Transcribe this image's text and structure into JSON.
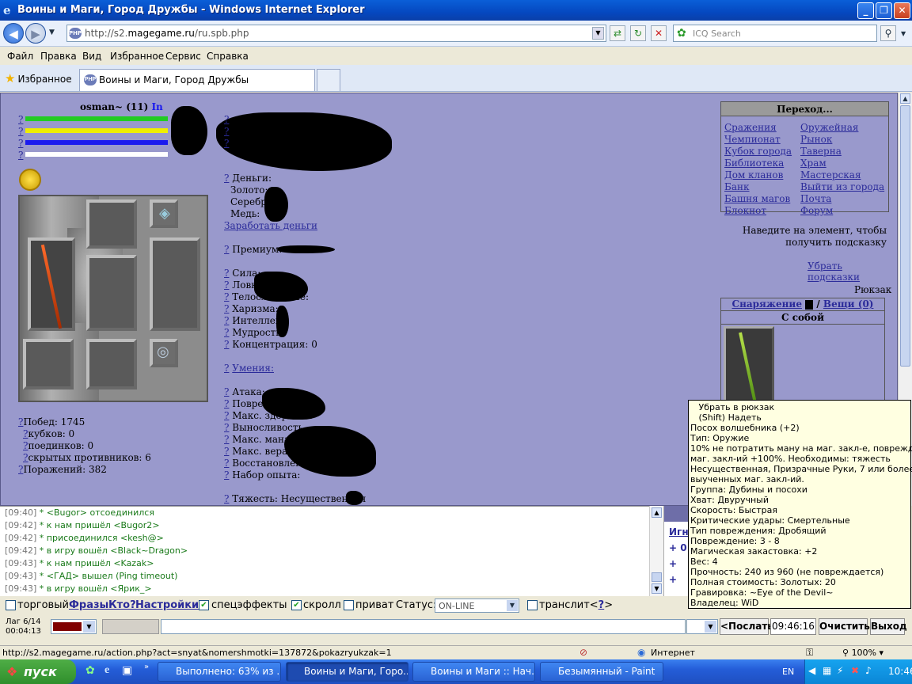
{
  "window": {
    "title": "Воины и Маги, Город Дружбы - Windows Internet Explorer",
    "min": "_",
    "max": "❐",
    "close": "✕"
  },
  "address": {
    "url_prefix": "http://s2.",
    "url_host": "magegame.ru",
    "url_path": "/ru.spb.php",
    "search_placeholder": "ICQ Search",
    "favicon": "PHP"
  },
  "menu": [
    "Файл",
    "Правка",
    "Вид",
    "Избранное",
    "Сервис",
    "Справка"
  ],
  "favorites": {
    "label": "Избранное",
    "tab_title": "Воины и Маги, Город Дружбы"
  },
  "character": {
    "name": "osman~ (11)",
    "in_label": "In",
    "bars": [
      {
        "color": "#22cc22",
        "fill": 1.0
      },
      {
        "color": "#eeee00",
        "fill": 1.0
      },
      {
        "color": "#1a1aee",
        "fill": 1.0
      },
      {
        "color": "#ffffff",
        "fill": 1.0
      }
    ],
    "q": "?",
    "wins": "Побед: 1745",
    "cups": "кубков: 0",
    "duels": "поединков: 0",
    "hidden": "скрытых противников: 6",
    "losses": "Поражений: 382"
  },
  "stats": {
    "money": "Деньги:",
    "gold": "Золото:",
    "silver": "Серебро",
    "copper": "Медь:",
    "earn": "Заработать деньги",
    "premium": "Премиум:",
    "strength": "Сила:",
    "agility": "Ловкость",
    "constitution": "Телосложение:",
    "charisma": "Харизма:",
    "intellect": "Интеллект:",
    "wisdom": "Мудрость:",
    "concentration": "Концентрация: 0",
    "skills": "Умения:",
    "attack": "Атака:",
    "damage": "Поврежден",
    "max_health": "Макс. здоровье:",
    "endurance": "Выносливость",
    "max_mana": "Макс. мана:",
    "max_faith": "Макс. вера:",
    "regen": "Восстановление здоровья:",
    "exp": "Набор опыта:",
    "weight": "Тяжесть: Несущественная"
  },
  "nav": {
    "header": "Переход...",
    "left": [
      "Сражения",
      "Чемпионат",
      "Кубок города",
      "Библиотека",
      "Дом кланов",
      "Банк",
      "Башня магов",
      "Блокнот"
    ],
    "right": [
      "Оружейная",
      "Рынок",
      "Таверна",
      "Храм",
      "Мастерская",
      "Выйти из города",
      "Почта",
      "Форум"
    ]
  },
  "hint": {
    "line1": "Наведите на элемент, чтобы",
    "line2": "получить подсказку",
    "remove": "Убрать подсказки"
  },
  "backpack": {
    "title": "Рюкзак",
    "gear": "Снаряжение",
    "things": "Вещи (0)",
    "slash": "/",
    "carry": "С собой"
  },
  "tooltip": [
    "   Убрать в рюкзак",
    "   (Shift) Надеть",
    "Посох волшебника (+2)",
    "Тип: Оружие",
    "10% не потратить ману на маг. закл-е, повреждение",
    "маг. закл-ий +100%. Необходимы: тяжесть",
    "Несущественная, Призрачные Руки, 7 или более",
    "выученных маг. закл-ий.",
    "Группа: Дубины и посохи",
    "Хват: Двуручный",
    "Скорость: Быстрая",
    "Критические удары: Смертельные",
    "Тип повреждения: Дробящий",
    "Повреждение: 3 - 8",
    "Магическая закастовка: +2",
    "Вес: 4",
    "Прочность: 240 из 960 (не повреждается)",
    "Полная стоимость: Золотых: 20",
    "Гравировка: ~Eye of the Devil~",
    "Владелец: WiD"
  ],
  "chat": [
    {
      "time": "[09:40]",
      "pre": "* <",
      "nick": "Bugor",
      "post": "> отсоединился"
    },
    {
      "time": "[09:42]",
      "pre": "* к нам пришёл <",
      "nick": "Bugor2",
      "post": ">"
    },
    {
      "time": "[09:42]",
      "pre": "* присоединился <",
      "nick": "kesh@",
      "post": ">"
    },
    {
      "time": "[09:42]",
      "pre": "* в игру вошёл <",
      "nick": "Black~Dragon",
      "post": ">"
    },
    {
      "time": "[09:43]",
      "pre": "* к нам пришёл <",
      "nick": "Kazak",
      "post": ">"
    },
    {
      "time": "[09:43]",
      "pre": "* <",
      "nick": "ГАД",
      "post": "> вышел (Ping timeout)"
    },
    {
      "time": "[09:43]",
      "pre": "* в игру вошёл <",
      "nick": "Ярик_",
      "post": ">"
    }
  ],
  "side": {
    "ignore": "Игн",
    "plus": "+",
    "zero": "0"
  },
  "controls": {
    "trade": "торговый",
    "phrases": "Фразы",
    "who": "Кто?",
    "settings": "Настройки",
    "effects": "спецэффекты",
    "scroll": "скролл",
    "private": "приват",
    "status_label": "Статус:",
    "status_value": "ON-LINE",
    "translit": "транслит<",
    "translit_q": "?",
    "translit_end": ">"
  },
  "input": {
    "lag": "Лаг 6/14",
    "timer": "00:04:13",
    "send": "<Послать",
    "clock": "09:46:16",
    "clear": "Очистить",
    "exit": "Выход"
  },
  "status": {
    "url": "http://s2.magegame.ru/action.php?act=snyat&nomershmotki=137872&pokazryukzak=1",
    "zone": "Интернет",
    "zoom": "100%"
  },
  "taskbar": {
    "start": "пуск",
    "tasks": [
      "Выполнено: 63% из ...",
      "Воины и Маги, Горо...",
      "Воины и Маги :: Нач...",
      "Безымянный - Paint"
    ],
    "lang": "EN",
    "time": "10:46"
  }
}
